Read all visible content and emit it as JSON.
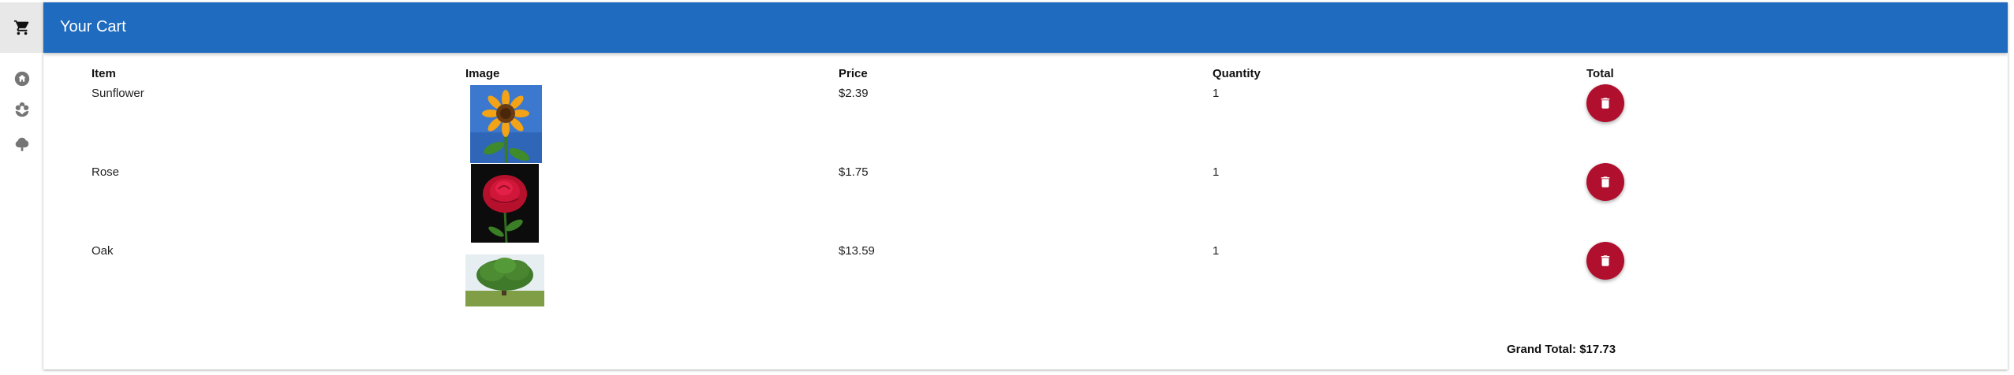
{
  "app": {
    "title": "Your Cart",
    "toolbar_color": "#1e6bbf",
    "accent_delete": "#b0102e"
  },
  "sidebar": {
    "items": [
      {
        "name": "cart",
        "icon": "cart-icon",
        "active": true
      },
      {
        "name": "home",
        "icon": "home-icon",
        "active": false
      },
      {
        "name": "flowers",
        "icon": "flower-icon",
        "active": false
      },
      {
        "name": "trees",
        "icon": "tree-icon",
        "active": false
      }
    ]
  },
  "cart": {
    "headers": {
      "item": "Item",
      "image": "Image",
      "price": "Price",
      "quantity": "Quantity",
      "total": "Total"
    },
    "rows": [
      {
        "item": "Sunflower",
        "image": "sunflower-photo",
        "price": "$2.39",
        "quantity": "1",
        "action_icon": "trash-icon"
      },
      {
        "item": "Rose",
        "image": "rose-photo",
        "price": "$1.75",
        "quantity": "1",
        "action_icon": "trash-icon"
      },
      {
        "item": "Oak",
        "image": "oak-tree-photo",
        "price": "$13.59",
        "quantity": "1",
        "action_icon": "trash-icon"
      }
    ],
    "grand_total": "Grand Total: $17.73"
  }
}
